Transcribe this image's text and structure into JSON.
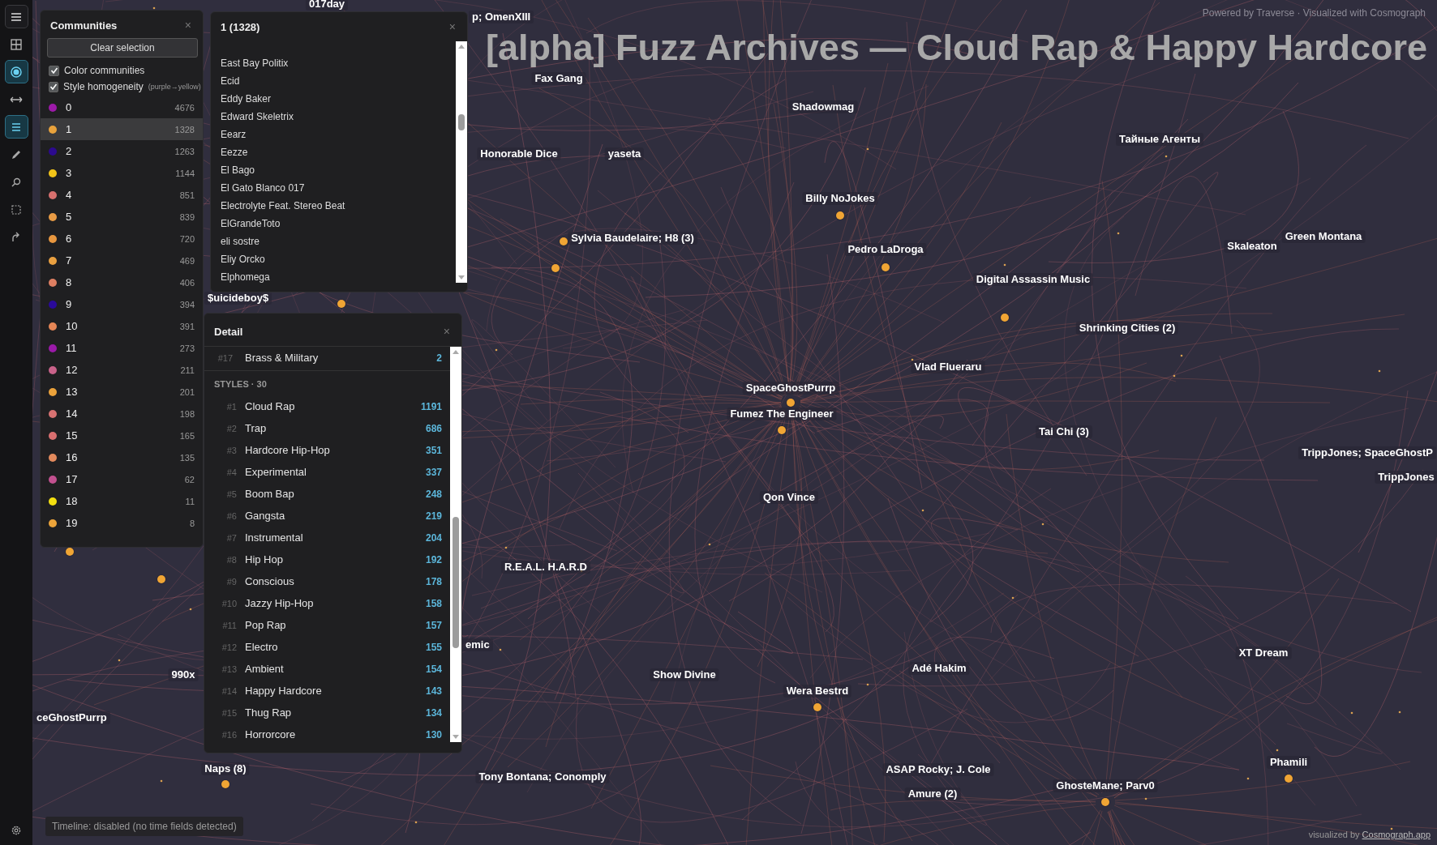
{
  "toolbar": [
    {
      "kind": "menu",
      "selected": false
    },
    {
      "kind": "grid",
      "selected": false
    },
    {
      "kind": "target",
      "selected": true
    },
    {
      "kind": "arrows",
      "selected": false
    },
    {
      "kind": "list",
      "selected": true
    },
    {
      "kind": "pencil",
      "selected": false
    },
    {
      "kind": "search",
      "selected": false
    },
    {
      "kind": "select",
      "selected": false
    },
    {
      "kind": "export",
      "selected": false
    },
    {
      "kind": "settings",
      "selected": false
    }
  ],
  "communities_panel": {
    "title": "Communities",
    "close": "×",
    "clear_button": "Clear selection",
    "options": [
      {
        "label": "Color communities",
        "checked": true
      },
      {
        "label": "Style homogeneity",
        "hint": "(purple→yellow)",
        "checked": true
      }
    ],
    "items": [
      {
        "label": "0",
        "count": "4676",
        "color": "#9c1aa8",
        "selected": false
      },
      {
        "label": "1",
        "count": "1328",
        "color": "#e8a23c",
        "selected": true
      },
      {
        "label": "2",
        "count": "1263",
        "color": "#2c0a8e",
        "selected": false
      },
      {
        "label": "3",
        "count": "1144",
        "color": "#f2c418",
        "selected": false
      },
      {
        "label": "4",
        "count": "851",
        "color": "#d7706e",
        "selected": false
      },
      {
        "label": "5",
        "count": "839",
        "color": "#e89b45",
        "selected": false
      },
      {
        "label": "6",
        "count": "720",
        "color": "#e8973f",
        "selected": false
      },
      {
        "label": "7",
        "count": "469",
        "color": "#e9a040",
        "selected": false
      },
      {
        "label": "8",
        "count": "406",
        "color": "#de7f62",
        "selected": false
      },
      {
        "label": "9",
        "count": "394",
        "color": "#2a0a9a",
        "selected": false
      },
      {
        "label": "10",
        "count": "391",
        "color": "#e58656",
        "selected": false
      },
      {
        "label": "11",
        "count": "273",
        "color": "#9a1aa8",
        "selected": false
      },
      {
        "label": "12",
        "count": "211",
        "color": "#c9628a",
        "selected": false
      },
      {
        "label": "13",
        "count": "201",
        "color": "#eba23b",
        "selected": false
      },
      {
        "label": "14",
        "count": "198",
        "color": "#d87272",
        "selected": false
      },
      {
        "label": "15",
        "count": "165",
        "color": "#d96f70",
        "selected": false
      },
      {
        "label": "16",
        "count": "135",
        "color": "#e38a5d",
        "selected": false
      },
      {
        "label": "17",
        "count": "62",
        "color": "#c2508f",
        "selected": false
      },
      {
        "label": "18",
        "count": "11",
        "color": "#f3df10",
        "selected": false
      },
      {
        "label": "19",
        "count": "8",
        "color": "#eca43a",
        "selected": false
      }
    ]
  },
  "list_panel": {
    "title": "1 (1328)",
    "close": "×",
    "items": [
      "East Bay Politix",
      "Ecid",
      "Eddy Baker",
      "Edward Skeletrix",
      "Eearz",
      "Eezze",
      "El Bago",
      "El Gato Blanco 017",
      "Electrolyte Feat. Stereo Beat",
      "ElGrandeToto",
      "eli sostre",
      "Eliy Orcko",
      "Elphomega"
    ]
  },
  "detail_panel": {
    "title": "Detail",
    "close": "×",
    "top_item": {
      "rank": "#17",
      "name": "Brass & Military",
      "count": "2"
    },
    "section": "STYLES · 30",
    "styles": [
      {
        "rank": "#1",
        "name": "Cloud Rap",
        "count": "1191"
      },
      {
        "rank": "#2",
        "name": "Trap",
        "count": "686"
      },
      {
        "rank": "#3",
        "name": "Hardcore Hip-Hop",
        "count": "351"
      },
      {
        "rank": "#4",
        "name": "Experimental",
        "count": "337"
      },
      {
        "rank": "#5",
        "name": "Boom Bap",
        "count": "248"
      },
      {
        "rank": "#6",
        "name": "Gangsta",
        "count": "219"
      },
      {
        "rank": "#7",
        "name": "Instrumental",
        "count": "204"
      },
      {
        "rank": "#8",
        "name": "Hip Hop",
        "count": "192"
      },
      {
        "rank": "#9",
        "name": "Conscious",
        "count": "178"
      },
      {
        "rank": "#10",
        "name": "Jazzy Hip-Hop",
        "count": "158"
      },
      {
        "rank": "#11",
        "name": "Pop Rap",
        "count": "157"
      },
      {
        "rank": "#12",
        "name": "Electro",
        "count": "155"
      },
      {
        "rank": "#13",
        "name": "Ambient",
        "count": "154"
      },
      {
        "rank": "#14",
        "name": "Happy Hardcore",
        "count": "143"
      },
      {
        "rank": "#15",
        "name": "Thug Rap",
        "count": "134"
      },
      {
        "rank": "#16",
        "name": "Horrorcore",
        "count": "130"
      }
    ]
  },
  "graph": {
    "title": "[alpha] Fuzz Archives — Cloud Rap & Happy Hardcore",
    "credit": "Powered by Traverse · Visualized with Cosmograph",
    "labels": [
      "017day",
      "p; OmenXIII",
      "Fax Gang",
      "Shadowmag",
      "Тайные Агенты",
      "Honorable Dice",
      "yaseta",
      "Billy NoJokes",
      "Sylvia Baudelaire; H8 (3)",
      "Pedro LaDroga",
      "Skaleaton",
      "Green Montana",
      "Digital Assassin Music",
      "$uicideboy$",
      "Shrinking Cities (2)",
      "Vlad Flueraru",
      "SpaceGhostPurrp",
      "Fumez The Engineer",
      "Tai Chi (3)",
      "TrippJones; SpaceGhostP",
      "TrippJones",
      "Qon Vince",
      "R.E.A.L. H.A.R.D",
      "emic",
      "990x",
      "ceGhostPurrp",
      "Show Divine",
      "Adé Hakim",
      "Wera Bestrd",
      "XT Dream",
      "Phamili",
      "Naps (8)",
      "Tony Bontana; Conomply",
      "ASAP Rocky; J. Cole",
      "Amure (2)",
      "GhosteMane; Parv0"
    ],
    "timeline": "Timeline: disabled (no time fields detected)",
    "footer": {
      "prefix": "visualized by",
      "link": "Cosmograph.app"
    }
  }
}
